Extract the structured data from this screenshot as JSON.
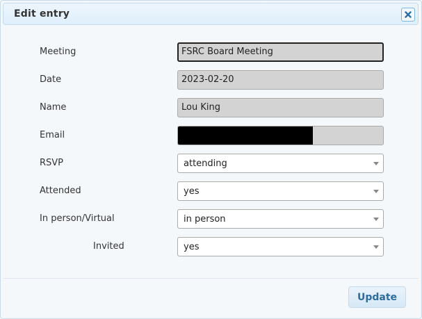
{
  "dialog": {
    "title": "Edit entry",
    "close_icon": "close-icon"
  },
  "fields": {
    "meeting": {
      "label": "Meeting",
      "value": "FSRC Board Meeting"
    },
    "date": {
      "label": "Date",
      "value": "2023-02-20"
    },
    "name": {
      "label": "Name",
      "value": "Lou King"
    },
    "email": {
      "label": "Email",
      "value": ""
    },
    "rsvp": {
      "label": "RSVP",
      "value": "attending"
    },
    "attended": {
      "label": "Attended",
      "value": "yes"
    },
    "in_person": {
      "label": "In person/Virtual",
      "value": "in person"
    },
    "invited": {
      "label": "Invited",
      "value": "yes"
    }
  },
  "buttons": {
    "update": "Update"
  },
  "colors": {
    "accent": "#2e6e9e",
    "border": "#c5dbec",
    "readonly_bg": "#d3d3d3",
    "redaction": "#000000"
  }
}
